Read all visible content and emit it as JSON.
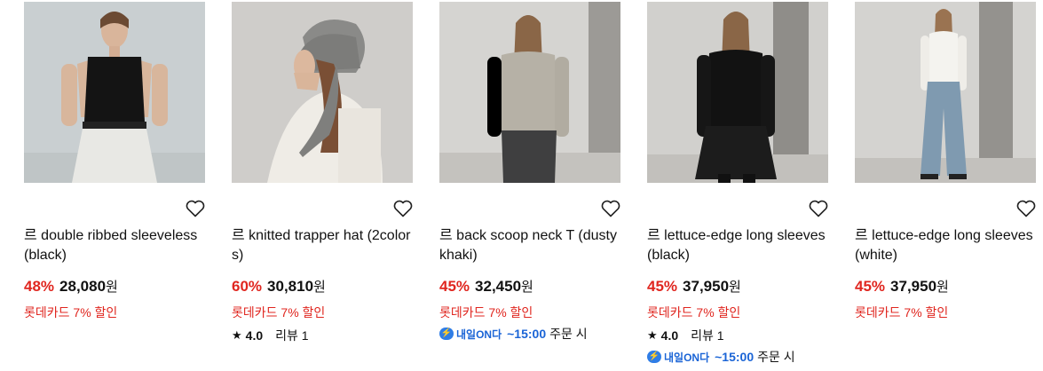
{
  "products": [
    {
      "title": "르 double ribbed sleeveless (black)",
      "discount": "48%",
      "price": "28,080",
      "currency": "원",
      "promo": "롯데카드 7% 할인",
      "image": "model-black-sleeveless-icon"
    },
    {
      "title": "르 knitted trapper hat (2colors)",
      "discount": "60%",
      "price": "30,810",
      "currency": "원",
      "promo": "롯데카드 7% 할인",
      "rating": "4.0",
      "reviews": "리뷰 1",
      "image": "model-grey-hat-icon"
    },
    {
      "title": "르 back scoop neck T (dusty khaki)",
      "discount": "45%",
      "price": "32,450",
      "currency": "원",
      "promo": "롯데카드 7% 할인",
      "delivery_badge": "내일ON다",
      "delivery_time": "~15:00",
      "delivery_suffix": "주문 시",
      "image": "model-khaki-tee-icon"
    },
    {
      "title": "르 lettuce-edge long sleeves (black)",
      "discount": "45%",
      "price": "37,950",
      "currency": "원",
      "promo": "롯데카드 7% 할인",
      "rating": "4.0",
      "reviews": "리뷰 1",
      "delivery_badge": "내일ON다",
      "delivery_time": "~15:00",
      "delivery_suffix": "주문 시",
      "image": "model-black-longsleeve-icon"
    },
    {
      "title": "르 lettuce-edge long sleeves (white)",
      "discount": "45%",
      "price": "37,950",
      "currency": "원",
      "promo": "롯데카드 7% 할인",
      "image": "model-white-longsleeve-icon"
    }
  ]
}
